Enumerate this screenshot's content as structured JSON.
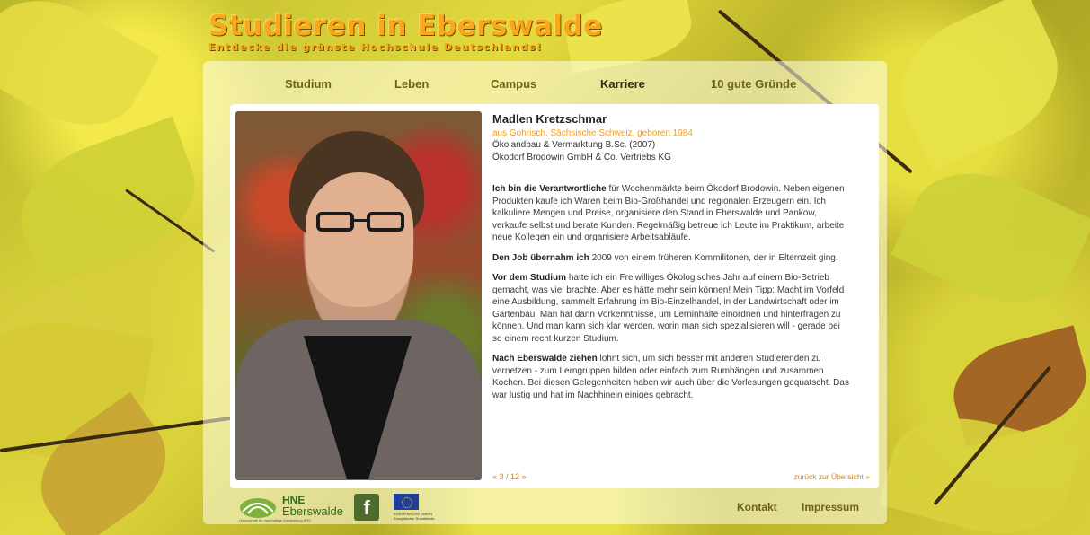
{
  "brand": {
    "title": "Studieren in Eberswalde",
    "subtitle": "Entdecke die grünste Hochschule Deutschlands!"
  },
  "nav": [
    {
      "label": "Studium"
    },
    {
      "label": "Leben"
    },
    {
      "label": "Campus"
    },
    {
      "label": "Karriere",
      "active": true
    },
    {
      "label": "10 gute Gründe"
    }
  ],
  "profile": {
    "name": "Madlen Kretzschmar",
    "origin": "aus Gohrisch, Sächsische Schweiz, geboren 1984",
    "degree": "Ökolandbau & Vermarktung B.Sc. (2007)",
    "employer": "Ökodorf Brodowin GmbH & Co. Vertriebs KG",
    "paragraphs": [
      {
        "lead": "Ich bin die Verantwortliche",
        "text": " für Wochenmärkte beim Ökodorf Brodowin. Neben eigenen Produkten kaufe ich Waren beim Bio-Großhandel und regionalen Erzeugern ein. Ich kalkuliere Mengen und Preise, organisiere den Stand in Eberswalde und Pankow, verkaufe selbst und berate Kunden. Regelmäßig betreue ich Leute im Praktikum, arbeite neue Kollegen ein und organisiere Arbeitsabläufe."
      },
      {
        "lead": "Den Job übernahm ich",
        "text": " 2009 von einem früheren Kommilitonen, der in Elternzeit ging."
      },
      {
        "lead": "Vor dem Studium",
        "text": " hatte ich ein Freiwilliges Ökologisches Jahr auf einem Bio-Betrieb gemacht, was viel brachte. Aber es hätte mehr sein können! Mein Tipp: Macht im Vorfeld eine Ausbildung, sammelt Erfahrung im Bio-Einzelhandel, in der Landwirtschaft oder im Gartenbau. Man hat dann Vorkenntnisse, um Lerninhalte einordnen und hinterfragen zu können. Und man kann sich klar werden, worin man sich spezialisieren will - gerade bei so einem recht kurzen Studium."
      },
      {
        "lead": "Nach Eberswalde ziehen",
        "text": " lohnt sich, um sich besser mit anderen Studierenden zu vernetzen - zum Lerngruppen bilden oder einfach zum Rumhängen und zusammen Kochen. Bei diesen Gelegenheiten haben wir auch über die Vorlesungen gequatscht. Das war lustig und hat im Nachhinein einiges gebracht."
      }
    ]
  },
  "pager": {
    "label": "« 3 / 12 »"
  },
  "back": {
    "label": "zurück zur Übersicht »"
  },
  "footer": {
    "hne_line1": "HNE",
    "hne_line2": "Eberswalde",
    "hne_tagline": "Hochschule für nachhaltige Entwicklung (FH)",
    "fb_glyph": "f",
    "eu_line1": "EUROPÄISCHE UNION",
    "eu_line2": "Europäischer Sozialfonds",
    "links": [
      {
        "label": "Kontakt"
      },
      {
        "label": "Impressum"
      }
    ]
  },
  "colors": {
    "accent": "#f7a81b",
    "nav": "#6b6412",
    "link": "#c88a1f",
    "hne": "#2f6b22"
  }
}
